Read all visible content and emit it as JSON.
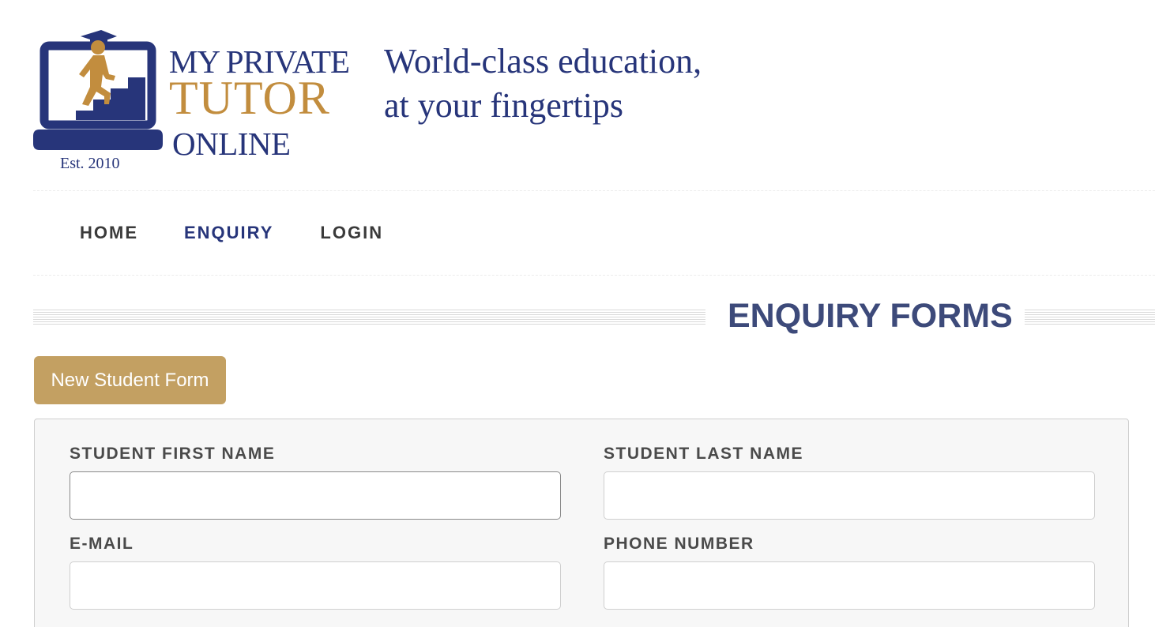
{
  "header": {
    "brand": {
      "line1": "MY PRIVATE",
      "line2": "TUTOR",
      "line3": "ONLINE",
      "est": "Est. 2010"
    },
    "tagline": {
      "line1": "World-class education,",
      "line2": "at your fingertips"
    }
  },
  "nav": {
    "items": [
      {
        "label": "HOME",
        "active": false
      },
      {
        "label": "ENQUIRY",
        "active": true
      },
      {
        "label": "LOGIN",
        "active": false
      }
    ]
  },
  "section": {
    "title": "ENQUIRY FORMS"
  },
  "buttons": {
    "new_student": "New Student Form"
  },
  "form": {
    "fields": [
      {
        "label": "STUDENT FIRST NAME",
        "value": ""
      },
      {
        "label": "STUDENT LAST NAME",
        "value": ""
      },
      {
        "label": "E-MAIL",
        "value": ""
      },
      {
        "label": "PHONE NUMBER",
        "value": ""
      }
    ]
  },
  "colors": {
    "brand_navy": "#27357a",
    "brand_gold": "#c28d3e",
    "button_gold": "#c3a062",
    "title_blue": "#3d4a7a"
  }
}
